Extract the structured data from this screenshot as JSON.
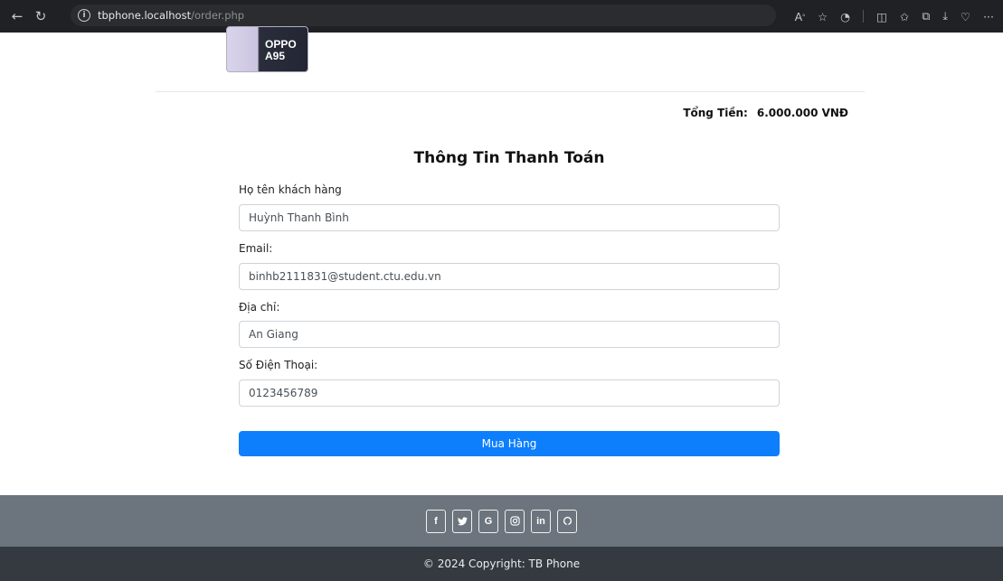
{
  "browser": {
    "host": "tbphone.localhost",
    "path": "/order.php",
    "icons": [
      "back-icon",
      "refresh-icon",
      "info-icon",
      "read-aloud-icon",
      "favorite-icon",
      "extension-icon",
      "split-screen-icon",
      "favorites-icon",
      "collections-icon",
      "download-icon",
      "health-icon",
      "more-icon"
    ]
  },
  "product": {
    "thumb_label_line1": "OPPO",
    "thumb_label_line2": "A95"
  },
  "total": {
    "label": "Tổng Tiền:",
    "value": "6.000.000 VNĐ"
  },
  "form": {
    "title": "Thông Tin Thanh Toán",
    "name_label": "Họ tên khách hàng",
    "name_value": "Huỳnh Thanh Bình",
    "email_label": "Email:",
    "email_value": "binhb2111831@student.ctu.edu.vn",
    "address_label": "Địa chỉ:",
    "address_value": "An Giang",
    "phone_label": "Số Điện Thoại:",
    "phone_value": "0123456789",
    "submit_label": "Mua Hàng"
  },
  "footer": {
    "social": [
      {
        "name": "facebook",
        "glyph": "f"
      },
      {
        "name": "twitter",
        "glyph": "🐦"
      },
      {
        "name": "google",
        "glyph": "G"
      },
      {
        "name": "instagram",
        "glyph": "◎"
      },
      {
        "name": "linkedin",
        "glyph": "in"
      },
      {
        "name": "github",
        "glyph": "○"
      }
    ],
    "copyright": "© 2024 Copyright: TB Phone"
  }
}
